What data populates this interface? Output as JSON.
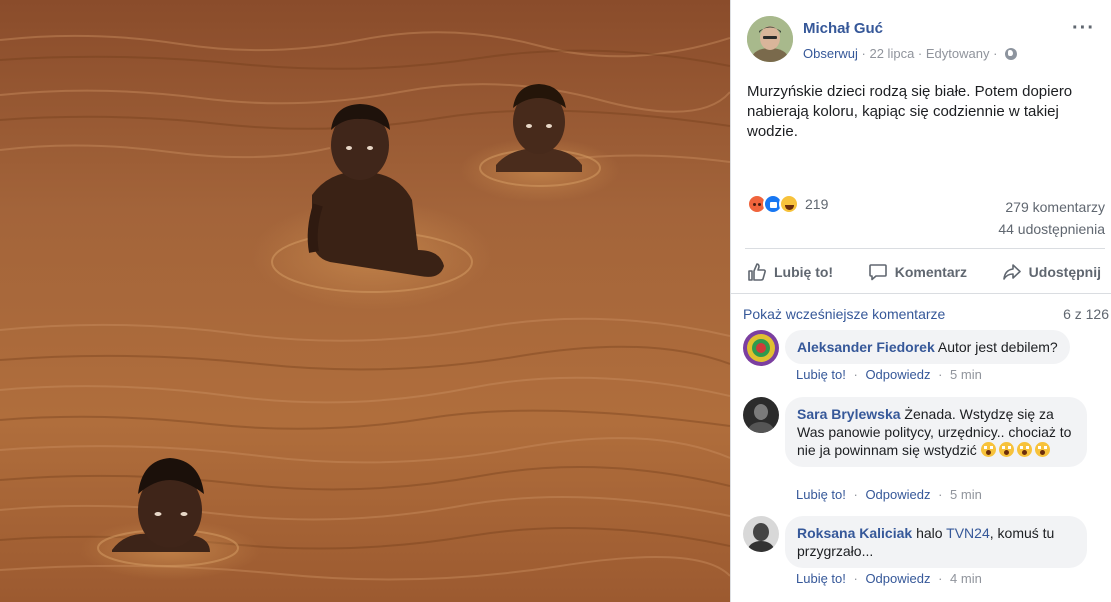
{
  "post": {
    "author": "Michał Guć",
    "follow_label": "Obserwuj",
    "meta_sep1": " · ",
    "date": "22 lipca",
    "meta_sep2": " · ",
    "edited": "Edytowany",
    "meta_sep3": " · ",
    "more_label": "···",
    "text": "Murzyńskie dzieci rodzą się białe. Potem dopiero nabierają koloru, kąpiąc się codziennie w takiej wodzie.",
    "reaction_count": "219",
    "comments_count": "279 komentarzy",
    "shares_count": "44 udostępnienia",
    "icons": [
      "ellipsis-icon",
      "globe-icon",
      "angry-reaction-icon",
      "like-reaction-icon",
      "haha-reaction-icon",
      "thumbs-up-icon",
      "comment-icon",
      "share-icon"
    ]
  },
  "actions": {
    "like": "Lubię to!",
    "comment": "Komentarz",
    "share": "Udostępnij"
  },
  "comments_bar": {
    "prev_label": "Pokaż wcześniejsze komentarze",
    "count": "6 z 126"
  },
  "comments": [
    {
      "author": "Aleksander Fiedorek",
      "text": "Autor jest debilem?",
      "like": "Lubię to!",
      "sep1": " · ",
      "reply": "Odpowiedz",
      "sep2": " · ",
      "time": "5 min"
    },
    {
      "author": "Sara Brylewska",
      "text": "Żenada. Wstydzę się za Was panowie politycy, urzędnicy.. chociaż to nie ja powinnam się wstydzić",
      "like": "Lubię to!",
      "sep1": " · ",
      "reply": "Odpowiedz",
      "sep2": " · ",
      "time": "5 min"
    },
    {
      "author": "Roksana Kaliciak",
      "text_before": "halo ",
      "link": "TVN24",
      "text_after": ", komuś tu przygrzało...",
      "like": "Lubię to!",
      "sep1": " · ",
      "reply": "Odpowiedz",
      "sep2": " · ",
      "time": "4 min"
    }
  ],
  "colors": {
    "link": "#365899",
    "muted": "#90949c",
    "bubble": "#f2f3f5",
    "water": "#a6673a"
  }
}
